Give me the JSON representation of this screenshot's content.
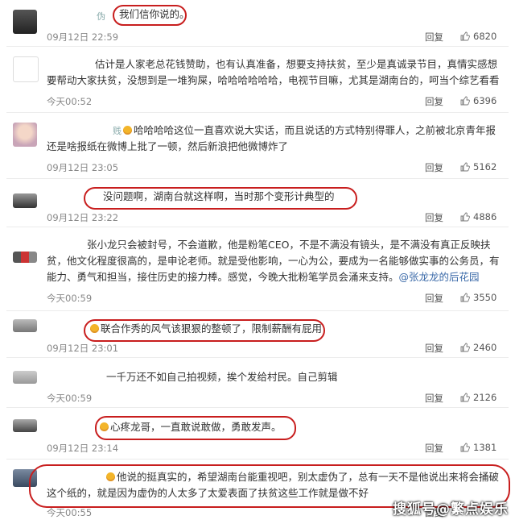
{
  "reply_label": "回复",
  "comments": [
    {
      "name": "伪",
      "text": "我们信你说的。",
      "time": "09月12日 22:59",
      "likes": "6820"
    },
    {
      "name": "",
      "text": "估计是人家老总花钱赞助，也有认真准备，想要支持扶贫，至少是真诚录节目，真情实感想要帮动大家扶贫，没想到是一堆狗屎，哈哈哈哈哈哈，电视节目嘛，尤其是湖南台的，呵当个综艺看看",
      "time": "今天00:52",
      "likes": "6396"
    },
    {
      "name": "贱",
      "text": "哈哈哈哈这位一直喜欢说大实话，而且说话的方式特别得罪人，之前被北京青年报还是啥报纸在微博上批了一顿，然后新浪把他微博炸了",
      "time": "09月12日 23:05",
      "likes": "5162"
    },
    {
      "name": "",
      "text": "没问题啊，湖南台就这样啊，当时那个变形计典型的",
      "time": "09月12日 23:22",
      "likes": "4886"
    },
    {
      "name": "",
      "text": "张小龙只会被封号，不会道歉，他是粉笔CEO，不是不满没有镜头，是不满没有真正反映扶贫，他文化程度很高的，是申论老师。就是受他影响，一心为公，要成为一名能够做实事的公务员，有能力、勇气和担当，接住历史的接力棒。感觉，今晚大批粉笔学员会涌来支持。",
      "link": "@张龙龙的后花园",
      "time": "今天00:59",
      "likes": "3550"
    },
    {
      "name": "",
      "text": "联合作秀的风气该狠狠的整顿了，限制薪酬有屁用",
      "time": "09月12日 23:01",
      "likes": "2460"
    },
    {
      "name": "",
      "text": "一千万还不如自己拍视频，挨个发给村民。自己剪辑",
      "time": "今天00:59",
      "likes": "2126"
    },
    {
      "name": "",
      "text": "心疼龙哥，一直敢说敢做，勇敢发声。",
      "time": "09月12日 23:14",
      "likes": "1381"
    },
    {
      "name": "",
      "text": "他说的挺真实的，希望湖南台能重视吧，别太虚伪了，总有一天不是他说出来将会捅破这个纸的，就是因为虚伪的人太多了太爱表面了扶贫这些工作就是做不好",
      "time": "今天00:55",
      "likes": ""
    }
  ],
  "watermark": "搜狐号@繁点娱乐",
  "colors": {
    "highlight": "#c81e1e",
    "link": "#3b6aa8"
  }
}
